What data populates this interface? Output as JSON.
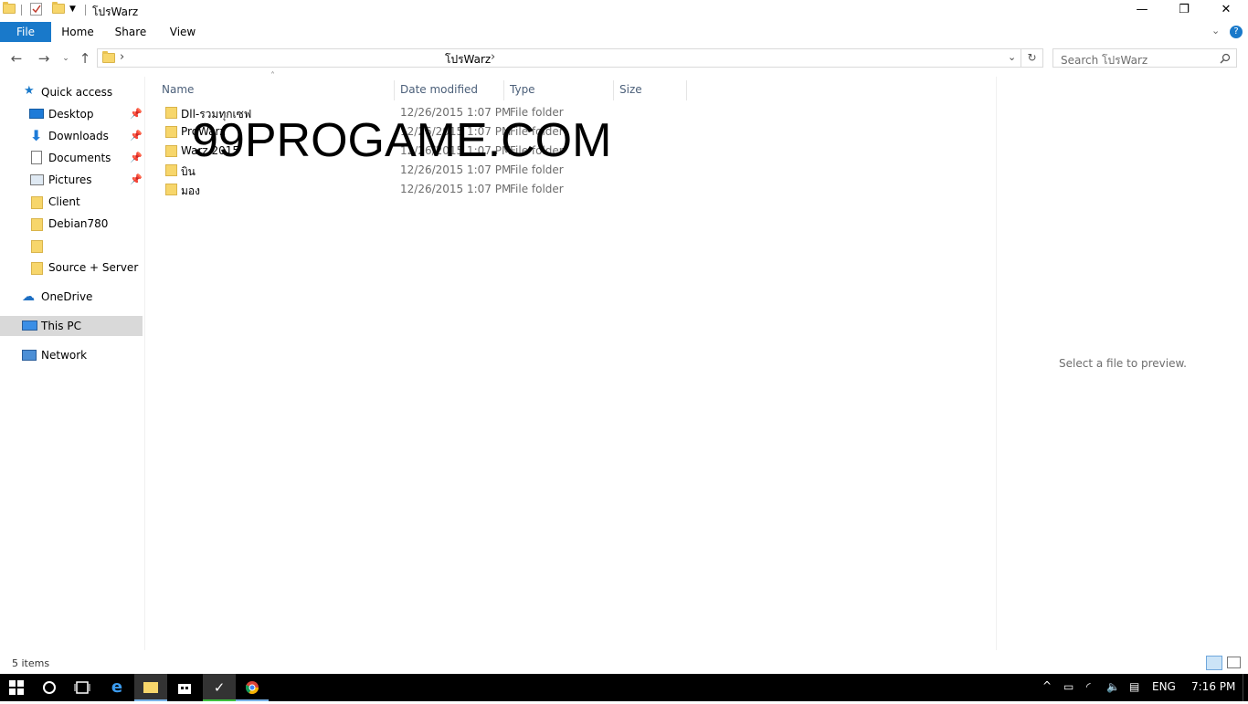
{
  "window": {
    "title": "โปรWarz",
    "minimize": "—",
    "maximize": "❐",
    "close": "✕"
  },
  "ribbon": {
    "tabs": [
      "File",
      "Home",
      "Share",
      "View"
    ]
  },
  "address": {
    "path": "โปรWarz",
    "chevron": "›"
  },
  "search": {
    "placeholder": "Search โปรWarz"
  },
  "nav_pane": {
    "quick_access": "Quick access",
    "items": [
      {
        "label": "Desktop",
        "icon": "desktop-icon",
        "pinned": true
      },
      {
        "label": "Downloads",
        "icon": "download-icon",
        "pinned": true
      },
      {
        "label": "Documents",
        "icon": "document-icon",
        "pinned": true
      },
      {
        "label": "Pictures",
        "icon": "pictures-icon",
        "pinned": true
      },
      {
        "label": "Client",
        "icon": "folder-icon",
        "pinned": false
      },
      {
        "label": "Debian780",
        "icon": "folder-icon",
        "pinned": false
      },
      {
        "label": "",
        "icon": "folder-icon",
        "pinned": false
      },
      {
        "label": "Source + Server",
        "icon": "folder-icon",
        "pinned": false
      }
    ],
    "onedrive": "OneDrive",
    "this_pc": "This PC",
    "network": "Network"
  },
  "columns": {
    "name": "Name",
    "date": "Date modified",
    "type": "Type",
    "size": "Size"
  },
  "files": [
    {
      "name": "Dll-รวมทุกเซฟ",
      "date": "12/26/2015 1:07 PM",
      "type": "File folder"
    },
    {
      "name": "ProWarz",
      "date": "12/26/2015 1:07 PM",
      "type": "File folder"
    },
    {
      "name": "Warz 2015",
      "date": "12/26/2015 1:07 PM",
      "type": "File folder"
    },
    {
      "name": "บิน",
      "date": "12/26/2015 1:07 PM",
      "type": "File folder"
    },
    {
      "name": "มอง",
      "date": "12/26/2015 1:07 PM",
      "type": "File folder"
    }
  ],
  "watermark": "99PROGAME.COM",
  "preview": {
    "text": "Select a file to preview."
  },
  "status": {
    "count": "5 items"
  },
  "taskbar": {
    "language": "ENG",
    "time": "7:16 PM"
  },
  "colors": {
    "file_tab": "#1979ca",
    "folder": "#f7d66b",
    "selected_nav": "#d9d9d9"
  }
}
